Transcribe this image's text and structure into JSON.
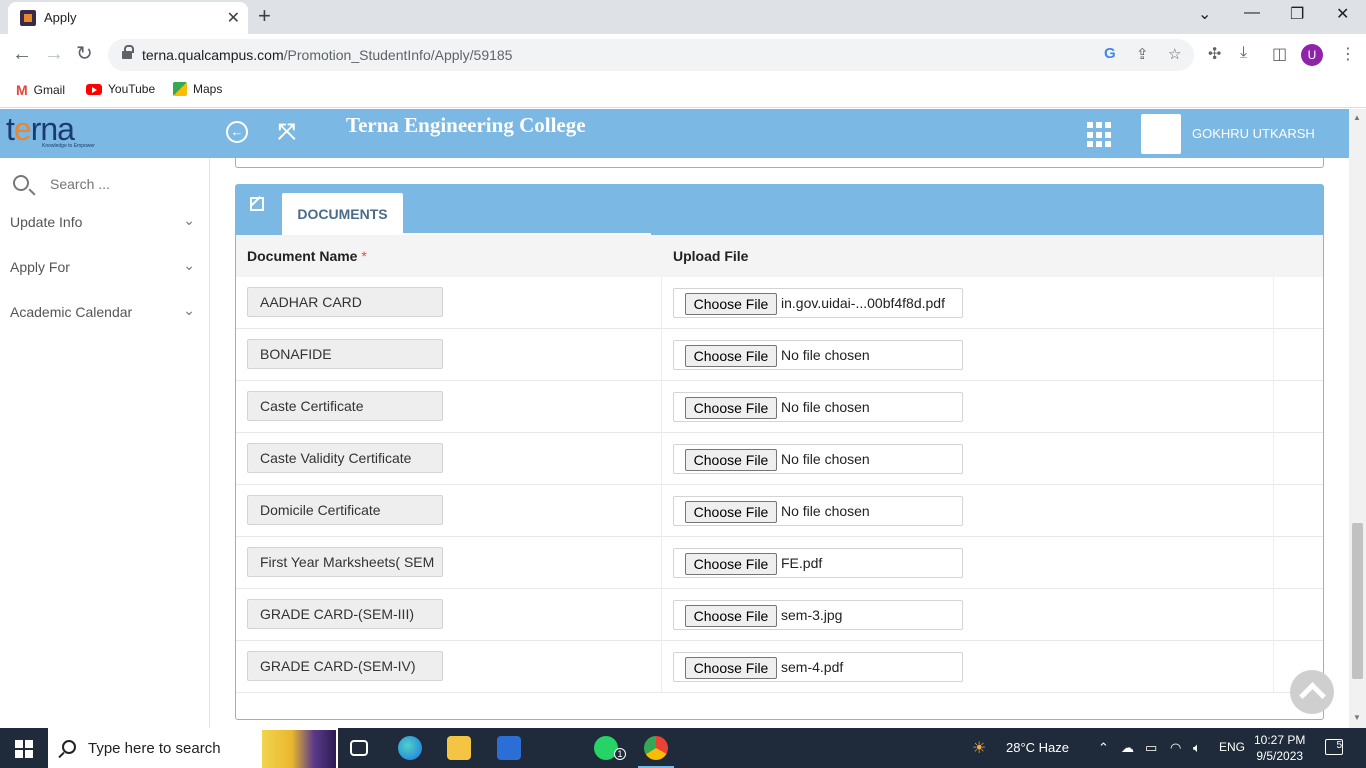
{
  "browser": {
    "tab_title": "Apply",
    "url_host": "terna.qualcampus.com",
    "url_path": "/Promotion_StudentInfo/Apply/59185",
    "profile_initial": "U",
    "bookmarks": [
      {
        "label": "Gmail"
      },
      {
        "label": "YouTube"
      },
      {
        "label": "Maps"
      }
    ]
  },
  "header": {
    "logo_text_pre": "t",
    "logo_text_o": "e",
    "logo_text_post": "rna",
    "logo_tagline": "Knowledge to Empower",
    "college_name": "Terna Engineering College",
    "user_name": "GOKHRU UTKARSH"
  },
  "sidebar": {
    "search_placeholder": "Search ...",
    "items": [
      {
        "label": "Update Info"
      },
      {
        "label": "Apply For"
      },
      {
        "label": "Academic Calendar"
      }
    ]
  },
  "documents": {
    "tab_label": "DOCUMENTS",
    "columns": {
      "name": "Document Name",
      "required_mark": "*",
      "upload": "Upload File"
    },
    "choose_label": "Choose File",
    "rows": [
      {
        "name": "AADHAR CARD",
        "file": "in.gov.uidai-...00bf4f8d.pdf"
      },
      {
        "name": "BONAFIDE",
        "file": "No file chosen"
      },
      {
        "name": "Caste Certificate",
        "file": "No file chosen"
      },
      {
        "name": "Caste Validity Certificate",
        "file": "No file chosen"
      },
      {
        "name": "Domicile Certificate",
        "file": "No file chosen"
      },
      {
        "name": "First Year Marksheets( SEM",
        "file": "FE.pdf"
      },
      {
        "name": "GRADE CARD-(SEM-III)",
        "file": "sem-3.jpg"
      },
      {
        "name": "GRADE CARD-(SEM-IV)",
        "file": "sem-4.pdf"
      }
    ]
  },
  "taskbar": {
    "search_placeholder": "Type here to search",
    "weather": "28°C  Haze",
    "language": "ENG",
    "time": "10:27 PM",
    "date": "9/5/2023",
    "notification_count": "5",
    "whatsapp_badge": "1"
  },
  "colors": {
    "header_blue": "#7bb8e3",
    "logo_navy": "#1b3a72",
    "logo_orange": "#e8872e",
    "required_red": "#e74c3c",
    "taskbar": "#1f2b3a"
  }
}
